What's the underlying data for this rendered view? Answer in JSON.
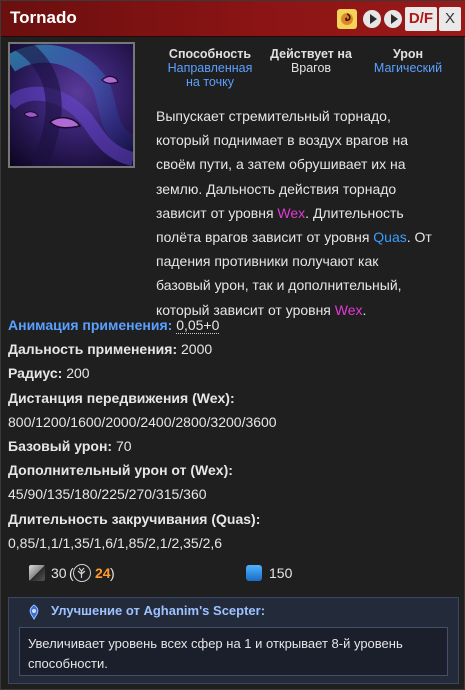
{
  "header": {
    "title": "Tornado",
    "df_label": "D/F",
    "close_label": "X",
    "icons": [
      "hotkey-icon",
      "play-icon",
      "play-icon"
    ]
  },
  "stats": {
    "ability_label": "Способность",
    "ability_value": "Направленная на точку",
    "ability_value_line1": "Направленная",
    "ability_value_line2": "на точку",
    "affects_label": "Действует на",
    "affects_value": "Врагов",
    "damage_label": "Урон",
    "damage_value": "Магический"
  },
  "description": {
    "l1": "Выпускает стремительный торнадо,",
    "l2": "который поднимает в воздух врагов на",
    "l3": "своём пути, а затем обрушивает их на",
    "l4": "землю. Дальность действия торнадо",
    "l5a": "зависит от уровня ",
    "l5b": "Wex",
    "l5c": ". Длительность",
    "l6a": "полёта врагов зависит от уровня ",
    "l6b": "Quas",
    "l6c": ". От",
    "l7": "падения противники получают как",
    "l8": "базовый урон, так и дополнительный,",
    "l9a": "который зависит от уровня ",
    "l9b": "Wex",
    "l9c": "."
  },
  "attributes": {
    "cast_anim_label": "Анимация применения:",
    "cast_anim_value": "0,05+0",
    "cast_range_label": "Дальность применения:",
    "cast_range_value": "2000",
    "radius_label": "Радиус:",
    "radius_value": "200",
    "travel_label_a": "Дистанция передвижения (",
    "travel_label_b": "Wex",
    "travel_label_c": "):",
    "travel_values": "800/1200/1600/2000/2400/2800/3200/3600",
    "base_dmg_label": "Базовый урон:",
    "base_dmg_value": "70",
    "extra_dmg_label_a": "Дополнительный урон от (",
    "extra_dmg_label_b": "Wex",
    "extra_dmg_label_c": "):",
    "extra_dmg_values": "45/90/135/180/225/270/315/360",
    "lift_label_a": "Длительность закручивания (",
    "lift_label_b": "Quas",
    "lift_label_c": "):",
    "lift_values": "0,85/1,1/1,35/1,6/1,85/2,1/2,35/2,6"
  },
  "costs": {
    "cooldown": "30",
    "paren_open": "(",
    "talent_cooldown": "24",
    "paren_close": ")",
    "mana": "150"
  },
  "aghanim": {
    "title": "Улучшение от Aghanim's Scepter:",
    "text_line1": "Увеличивает уровень всех сфер на 1 и открывает 8-й уровень",
    "text_line2": "способности."
  },
  "colors": {
    "header_red": "#8b1414",
    "wex": "#e23ad2",
    "quas": "#3a9cff",
    "talent": "#ff9a2b",
    "link_blue": "#5aa0ff"
  }
}
